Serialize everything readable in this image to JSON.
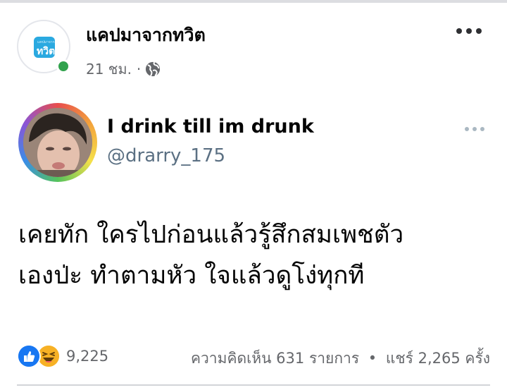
{
  "post": {
    "page_name": "แคปมาจากทวิต",
    "time": "21 ชม.",
    "separator": "·",
    "audience_icon": "globe-icon",
    "logo_small": "แคปมาจาก",
    "logo_text": "ทวิต"
  },
  "tweet": {
    "display_name": "I drink till im drunk",
    "handle": "@drarry_175",
    "text_lines": [
      "เคยทัก ใครไปก่อนแล้วรู้สึกสมเพชตัว",
      "เองป่ะ ทำตามหัว ใจแล้วดูโง่ทุกที"
    ]
  },
  "reactions": {
    "icons": [
      "like-icon",
      "haha-icon"
    ],
    "count": "9,225",
    "comments": "ความคิดเห็น 631 รายการ",
    "dot": "•",
    "shares": "แชร์ 2,265 ครั้ง"
  },
  "colors": {
    "like": "#1877f2",
    "haha": "#f7b125",
    "online": "#31a24c",
    "secondary_text": "#65676b",
    "twitter_handle": "#5b7083"
  }
}
